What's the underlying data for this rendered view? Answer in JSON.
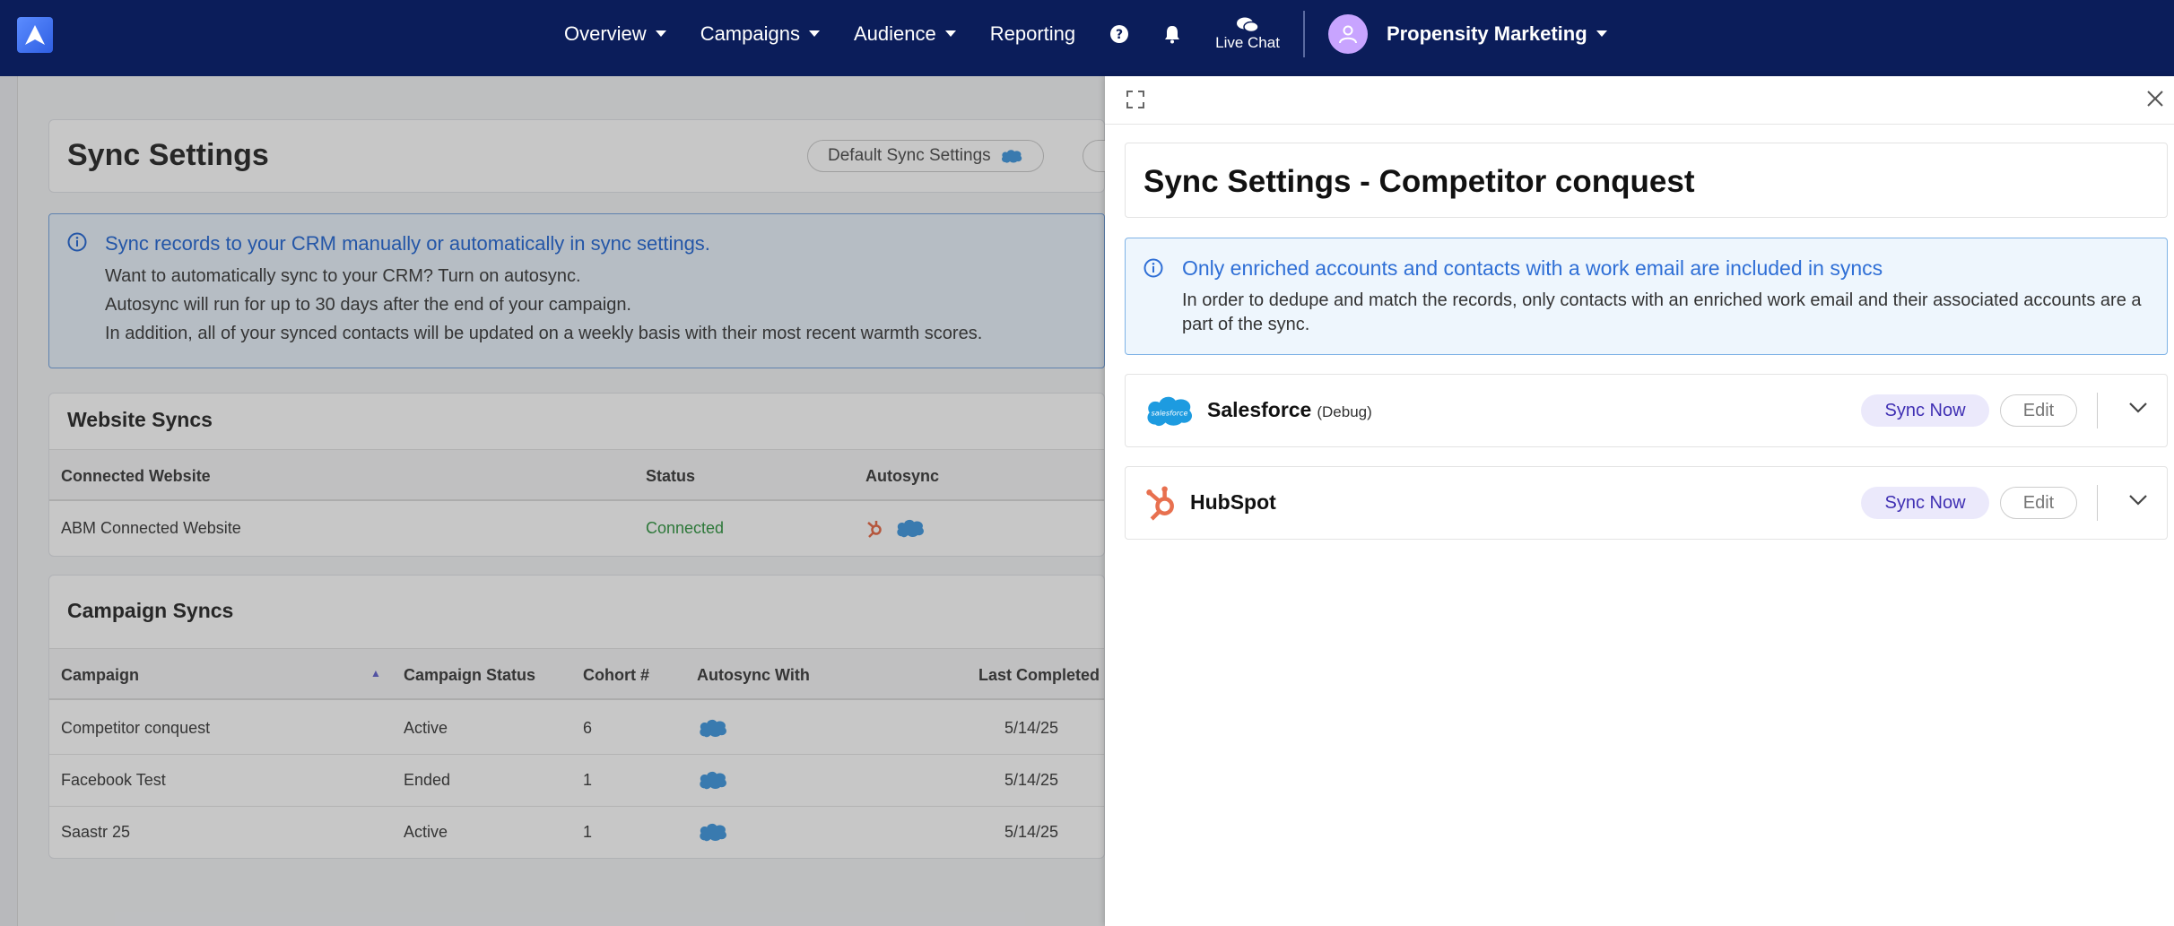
{
  "nav": {
    "items": [
      {
        "label": "Overview",
        "has_caret": true
      },
      {
        "label": "Campaigns",
        "has_caret": true
      },
      {
        "label": "Audience",
        "has_caret": true
      },
      {
        "label": "Reporting",
        "has_caret": false
      }
    ],
    "help_icon": "question-circle-icon",
    "bell_icon": "bell-icon",
    "live_chat_label": "Live Chat",
    "account_name": "Propensity Marketing",
    "colors": {
      "nav_bg": "#0b1d5a",
      "accent": "#2f6fd6",
      "sync_button_bg": "#ebe9fb",
      "sync_button_text": "#3f2fb3"
    }
  },
  "background_page": {
    "title": "Sync Settings",
    "default_sync_label": "Default Sync Settings",
    "info": {
      "title": "Sync records to your CRM manually or automatically in sync settings.",
      "lines": [
        "Want to automatically sync to your CRM? Turn on autosync.",
        "Autosync will run for up to 30 days after the end of your campaign.",
        "In addition, all of your synced contacts will be updated on a weekly basis with their most recent warmth scores."
      ]
    },
    "website_syncs": {
      "title": "Website Syncs",
      "columns": [
        "Connected Website",
        "Status",
        "Autosync"
      ],
      "rows": [
        {
          "website": "ABM Connected Website",
          "status": "Connected"
        }
      ]
    },
    "campaign_syncs": {
      "title": "Campaign Syncs",
      "columns": [
        "Campaign",
        "Campaign Status",
        "Cohort #",
        "Autosync With",
        "Last Completed"
      ],
      "rows": [
        {
          "campaign": "Competitor conquest",
          "status": "Active",
          "cohort": "6",
          "last_completed": "5/14/25"
        },
        {
          "campaign": "Facebook Test",
          "status": "Ended",
          "cohort": "1",
          "last_completed": "5/14/25"
        },
        {
          "campaign": "Saastr 25",
          "status": "Active",
          "cohort": "1",
          "last_completed": "5/14/25"
        }
      ]
    }
  },
  "panel": {
    "title": "Sync Settings - Competitor conquest",
    "info": {
      "title": "Only enriched accounts and contacts with a work email are included in syncs",
      "body": "In order to dedupe and match the records, only contacts with an enriched work email and their associated accounts are a part of the sync."
    },
    "crms": [
      {
        "name": "Salesforce",
        "tag": "(Debug)",
        "sync_label": "Sync Now",
        "edit_label": "Edit",
        "icon": "salesforce-icon"
      },
      {
        "name": "HubSpot",
        "tag": "",
        "sync_label": "Sync Now",
        "edit_label": "Edit",
        "icon": "hubspot-icon"
      }
    ]
  }
}
